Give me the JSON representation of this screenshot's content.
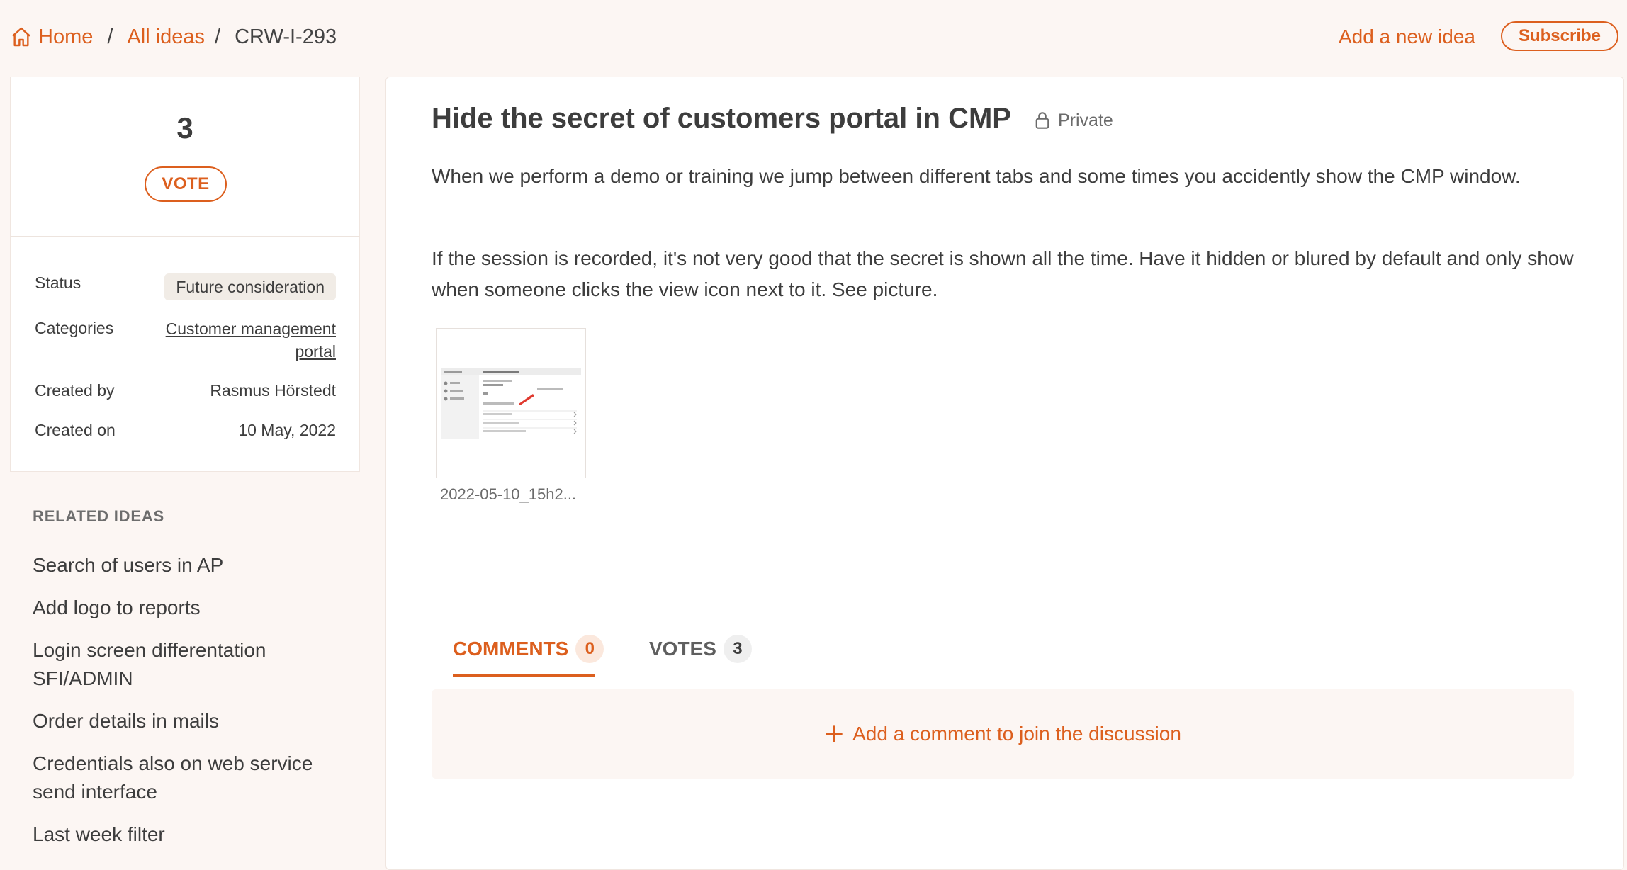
{
  "breadcrumb": {
    "home_icon": "home-icon",
    "home": "Home",
    "separator": "/",
    "all_ideas": "All ideas",
    "current": "CRW-I-293"
  },
  "header": {
    "add_idea": "Add a new idea",
    "subscribe": "Subscribe"
  },
  "vote": {
    "count": "3",
    "button": "VOTE"
  },
  "details": {
    "status_label": "Status",
    "status_value": "Future consideration",
    "categories_label": "Categories",
    "categories_value": "Customer management portal",
    "created_by_label": "Created by",
    "created_by_value": "Rasmus Hörstedt",
    "created_on_label": "Created on",
    "created_on_value": "10 May, 2022"
  },
  "related": {
    "title": "RELATED IDEAS",
    "items": [
      "Search of users in AP",
      "Add logo to reports",
      "Login screen differentation SFI/ADMIN",
      "Order details in mails",
      "Credentials also on web service send interface",
      "Last week filter"
    ]
  },
  "idea": {
    "title": "Hide the secret of customers portal in CMP",
    "visibility": "Private",
    "paragraph_1": "When we perform a demo or training we jump between different tabs and some times you accidently show the CMP window.",
    "paragraph_2": "If the session is recorded, it's not very good that the secret is shown all the time. Have it hidden or blured by default and only show when someone clicks the view icon next to it. See picture.",
    "attachment_name": "2022-05-10_15h2..."
  },
  "tabs": {
    "comments_label": "COMMENTS",
    "comments_count": "0",
    "votes_label": "VOTES",
    "votes_count": "3"
  },
  "comment_prompt": "Add a comment to join the discussion",
  "colors": {
    "accent": "#dc5f1e",
    "background": "#fcf6f3",
    "status_badge_bg": "#f1ece6"
  }
}
